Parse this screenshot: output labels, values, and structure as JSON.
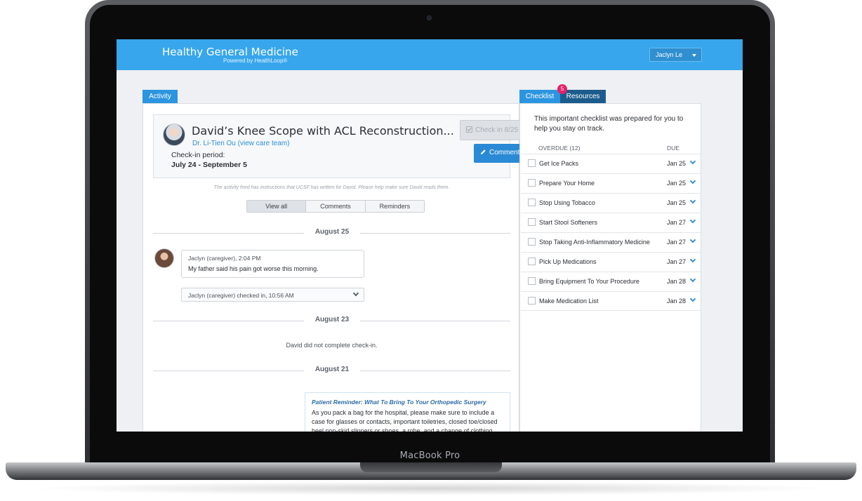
{
  "device": {
    "brand_label": "MacBook Pro"
  },
  "app": {
    "title": "Healthy General Medicine",
    "subtitle": "Powered by HealthLoop®",
    "user_menu": "Jaclyn Le"
  },
  "tabs": {
    "activity": "Activity",
    "checklist": "Checklist",
    "resources": "Resources",
    "resources_badge": "5"
  },
  "plan": {
    "title": "David’s Knee Scope with ACL Reconstruction...",
    "doctor": "Dr. Li-Tien Ou (view care team)",
    "period_label": "Check-in period:",
    "period_value": "July 24 - September 5",
    "checkin_button": "Check in 8/25",
    "comment_button": "Comment"
  },
  "feed": {
    "note": "The activity feed has instructions that UCSF has written for David. Please help make sure David reads them.",
    "filters": [
      "View all",
      "Comments",
      "Reminders"
    ],
    "active_filter": "View all",
    "dates": [
      "August 25",
      "August 23",
      "August 21"
    ],
    "comment": {
      "author_time": "Jaclyn (caregiver), 2:04 PM",
      "text": "My father said his pain got worse this morning."
    },
    "checkin_entry": "Jaclyn (caregiver) checked in, 10:56 AM",
    "no_checkin": "David did not complete check-in.",
    "reminder": {
      "title": "Patient Reminder: What To Bring To Your Orthopedic Surgery",
      "body": "As you pack a bag for the hospital, please make sure to include a case for glasses or contacts, important toiletries, closed toe/closed heel non-skid slippers or shoes, a robe, and a change of clothing."
    }
  },
  "checklist": {
    "intro": "This important checklist was prepared for you to help you stay on track.",
    "overdue_header": "OVERDUE (12)",
    "due_header": "DUE",
    "items": [
      {
        "label": "Get Ice Packs",
        "due": "Jan 25"
      },
      {
        "label": "Prepare Your Home",
        "due": "Jan 25"
      },
      {
        "label": "Stop Using Tobacco",
        "due": "Jan 25"
      },
      {
        "label": "Start Stool Softeners",
        "due": "Jan 27"
      },
      {
        "label": "Stop Taking Anti-Inflammatory Medicine",
        "due": "Jan 27"
      },
      {
        "label": "Pick Up Medications",
        "due": "Jan 27"
      },
      {
        "label": "Bring Equipment To Your Procedure",
        "due": "Jan 28"
      },
      {
        "label": "Make Medication List",
        "due": "Jan 28"
      }
    ]
  },
  "colors": {
    "header_blue": "#37a6ec",
    "accent_blue": "#2a8ad5",
    "badge_pink": "#e8206a",
    "dark_tab": "#1c5c8c"
  },
  "icons": {
    "checkin": "check-square-icon",
    "comment": "pencil-icon",
    "expand": "chevron-down-icon",
    "user_menu": "caret-down-icon"
  }
}
